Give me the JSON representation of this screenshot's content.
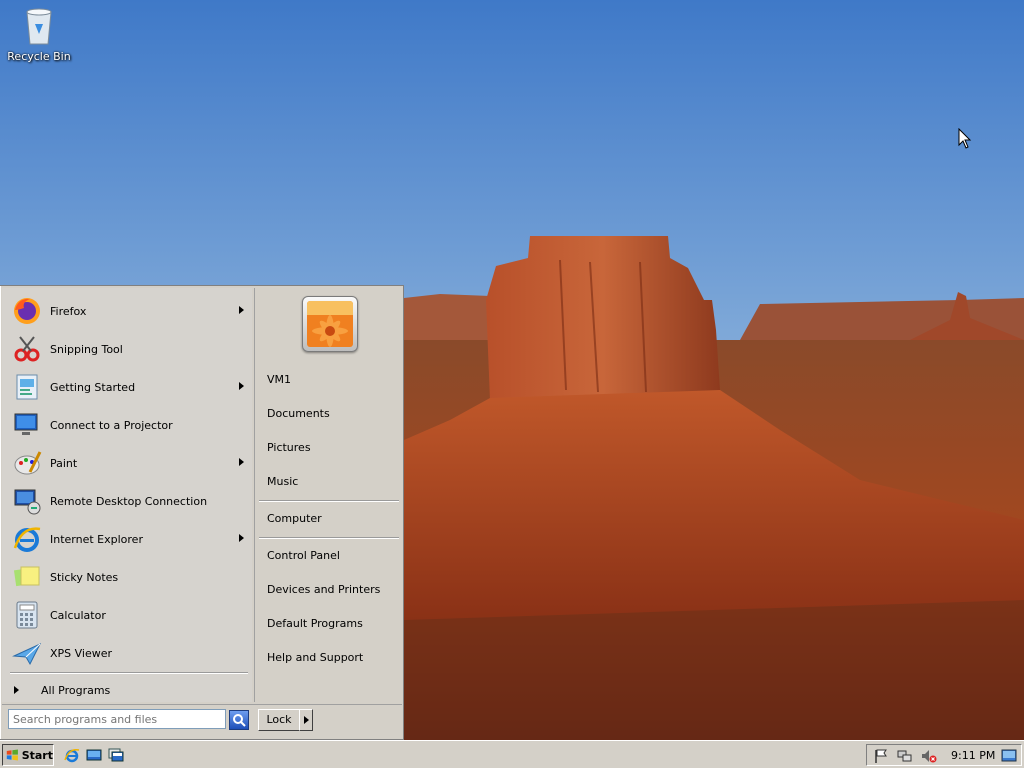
{
  "desktop": {
    "icons": [
      {
        "label": "Recycle Bin",
        "icon": "recycle-bin-icon"
      }
    ]
  },
  "start_menu": {
    "programs": [
      {
        "label": "Firefox",
        "icon": "firefox-icon",
        "has_submenu": true
      },
      {
        "label": "Snipping Tool",
        "icon": "snipping-tool-icon",
        "has_submenu": false
      },
      {
        "label": "Getting Started",
        "icon": "getting-started-icon",
        "has_submenu": true
      },
      {
        "label": "Connect to a Projector",
        "icon": "projector-icon",
        "has_submenu": false
      },
      {
        "label": "Paint",
        "icon": "paint-icon",
        "has_submenu": true
      },
      {
        "label": "Remote Desktop Connection",
        "icon": "remote-desktop-icon",
        "has_submenu": false
      },
      {
        "label": "Internet Explorer",
        "icon": "internet-explorer-icon",
        "has_submenu": true
      },
      {
        "label": "Sticky Notes",
        "icon": "sticky-notes-icon",
        "has_submenu": false
      },
      {
        "label": "Calculator",
        "icon": "calculator-icon",
        "has_submenu": false
      },
      {
        "label": "XPS Viewer",
        "icon": "xps-viewer-icon",
        "has_submenu": false
      }
    ],
    "all_programs_label": "All Programs",
    "right_items": {
      "user": "VM1",
      "documents": "Documents",
      "pictures": "Pictures",
      "music": "Music",
      "computer": "Computer",
      "control_panel": "Control Panel",
      "devices_printers": "Devices and Printers",
      "default_programs": "Default Programs",
      "help_support": "Help and Support"
    },
    "search_placeholder": "Search programs and files",
    "lock_label": "Lock"
  },
  "taskbar": {
    "start_label": "Start",
    "quick_launch": [
      "internet-explorer-icon",
      "show-desktop-icon",
      "switch-windows-icon"
    ],
    "tray_icons": [
      "action-center-flag-icon",
      "network-icon",
      "volume-muted-icon"
    ],
    "clock": "9:11 PM"
  },
  "colors": {
    "menu_bg": "#d4d0c8",
    "taskbar_bg": "#d4d0c8",
    "search_border": "#7f9db9"
  }
}
